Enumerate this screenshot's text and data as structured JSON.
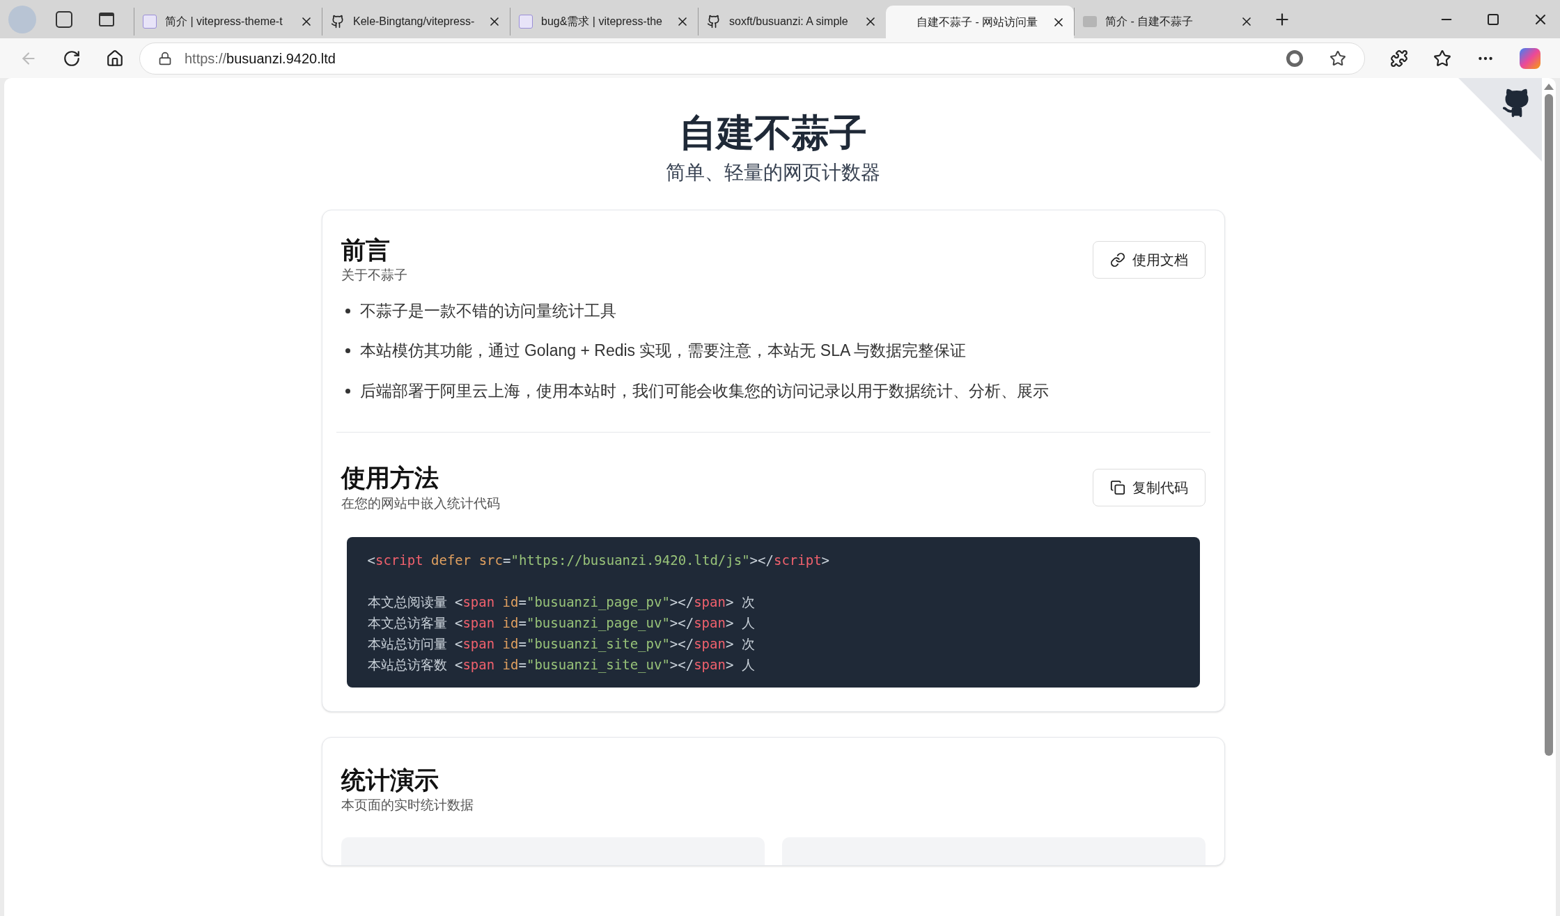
{
  "browser": {
    "tabs": [
      {
        "label": "简介 | vitepress-theme-t",
        "kind": "vitepress",
        "selected": false
      },
      {
        "label": "Kele-Bingtang/vitepress-",
        "kind": "github",
        "selected": false
      },
      {
        "label": "bug&需求 | vitepress-the",
        "kind": "vitepress",
        "selected": false
      },
      {
        "label": "soxft/busuanzi: A simple",
        "kind": "github",
        "selected": false
      },
      {
        "label": "自建不蒜子 - 网站访问量",
        "kind": "blank",
        "selected": true
      },
      {
        "label": "简介 - 自建不蒜子",
        "kind": "site",
        "selected": false
      }
    ],
    "url_scheme": "https://",
    "url_host": "busuanzi.9420.ltd"
  },
  "page": {
    "title": "自建不蒜子",
    "subtitle": "简单、轻量的网页计数器",
    "sections": [
      {
        "kind": "intro",
        "heading": "前言",
        "caption": "关于不蒜子",
        "button": "使用文档",
        "bullets": [
          "不蒜子是一款不错的访问量统计工具",
          "本站模仿其功能，通过 Golang + Redis 实现，需要注意，本站无 SLA 与数据完整保证",
          "后端部署于阿里云上海，使用本站时，我们可能会收集您的访问记录以用于数据统计、分析、展示"
        ]
      },
      {
        "kind": "usage",
        "heading": "使用方法",
        "caption": "在您的网站中嵌入统计代码",
        "button": "复制代码",
        "code": [
          [
            {
              "kind": "punct",
              "text": "<"
            },
            {
              "kind": "tag",
              "text": "script"
            },
            {
              "kind": "attr",
              "text": " defer src"
            },
            {
              "kind": "punct",
              "text": "="
            },
            {
              "kind": "string",
              "text": "\"https://busuanzi.9420.ltd/js\""
            },
            {
              "kind": "punct",
              "text": "></"
            },
            {
              "kind": "tag",
              "text": "script"
            },
            {
              "kind": "punct",
              "text": ">"
            }
          ],
          [
            {
              "kind": "punct",
              "text": "本文总阅读量 <"
            },
            {
              "kind": "tag",
              "text": "span"
            },
            {
              "kind": "attr",
              "text": " id"
            },
            {
              "kind": "punct",
              "text": "="
            },
            {
              "kind": "string",
              "text": "\"busuanzi_page_pv\""
            },
            {
              "kind": "punct",
              "text": "></"
            },
            {
              "kind": "tag",
              "text": "span"
            },
            {
              "kind": "punct",
              "text": "> 次"
            }
          ],
          [
            {
              "kind": "punct",
              "text": "本文总访客量 <"
            },
            {
              "kind": "tag",
              "text": "span"
            },
            {
              "kind": "attr",
              "text": " id"
            },
            {
              "kind": "punct",
              "text": "="
            },
            {
              "kind": "string",
              "text": "\"busuanzi_page_uv\""
            },
            {
              "kind": "punct",
              "text": "></"
            },
            {
              "kind": "tag",
              "text": "span"
            },
            {
              "kind": "punct",
              "text": "> 人"
            }
          ],
          [
            {
              "kind": "punct",
              "text": "本站总访问量 <"
            },
            {
              "kind": "tag",
              "text": "span"
            },
            {
              "kind": "attr",
              "text": " id"
            },
            {
              "kind": "punct",
              "text": "="
            },
            {
              "kind": "string",
              "text": "\"busuanzi_site_pv\""
            },
            {
              "kind": "punct",
              "text": "></"
            },
            {
              "kind": "tag",
              "text": "span"
            },
            {
              "kind": "punct",
              "text": "> 次"
            }
          ],
          [
            {
              "kind": "punct",
              "text": "本站总访客数 <"
            },
            {
              "kind": "tag",
              "text": "span"
            },
            {
              "kind": "attr",
              "text": " id"
            },
            {
              "kind": "punct",
              "text": "="
            },
            {
              "kind": "string",
              "text": "\"busuanzi_site_uv\""
            },
            {
              "kind": "punct",
              "text": "></"
            },
            {
              "kind": "tag",
              "text": "span"
            },
            {
              "kind": "punct",
              "text": "> 人"
            }
          ]
        ]
      },
      {
        "kind": "stats",
        "heading": "统计演示",
        "caption": "本页面的实时统计数据"
      }
    ]
  }
}
